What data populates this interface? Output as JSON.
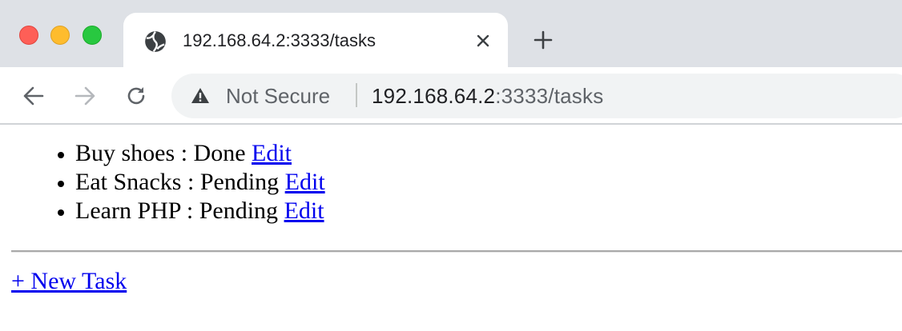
{
  "browser": {
    "tab": {
      "title": "192.168.64.2:3333/tasks",
      "favicon": "globe-icon"
    },
    "toolbar": {
      "security_label": "Not Secure",
      "url_host": "192.168.64.2",
      "url_path": ":3333/tasks"
    },
    "colors": {
      "tabstrip": "#dee1e6",
      "close_red": "#fe5f57",
      "minimize_yellow": "#febc2e",
      "zoom_green": "#28c840",
      "omnibox": "#f1f3f4"
    }
  },
  "page": {
    "tasks": [
      {
        "name": "Buy shoes",
        "separator": " : ",
        "status": "Done",
        "edit_label": "Edit"
      },
      {
        "name": "Eat Snacks",
        "separator": " : ",
        "status": "Pending",
        "edit_label": "Edit"
      },
      {
        "name": "Learn PHP",
        "separator": " : ",
        "status": "Pending",
        "edit_label": "Edit"
      }
    ],
    "new_task_label": "+ New Task",
    "link_color": "#0000ee"
  }
}
